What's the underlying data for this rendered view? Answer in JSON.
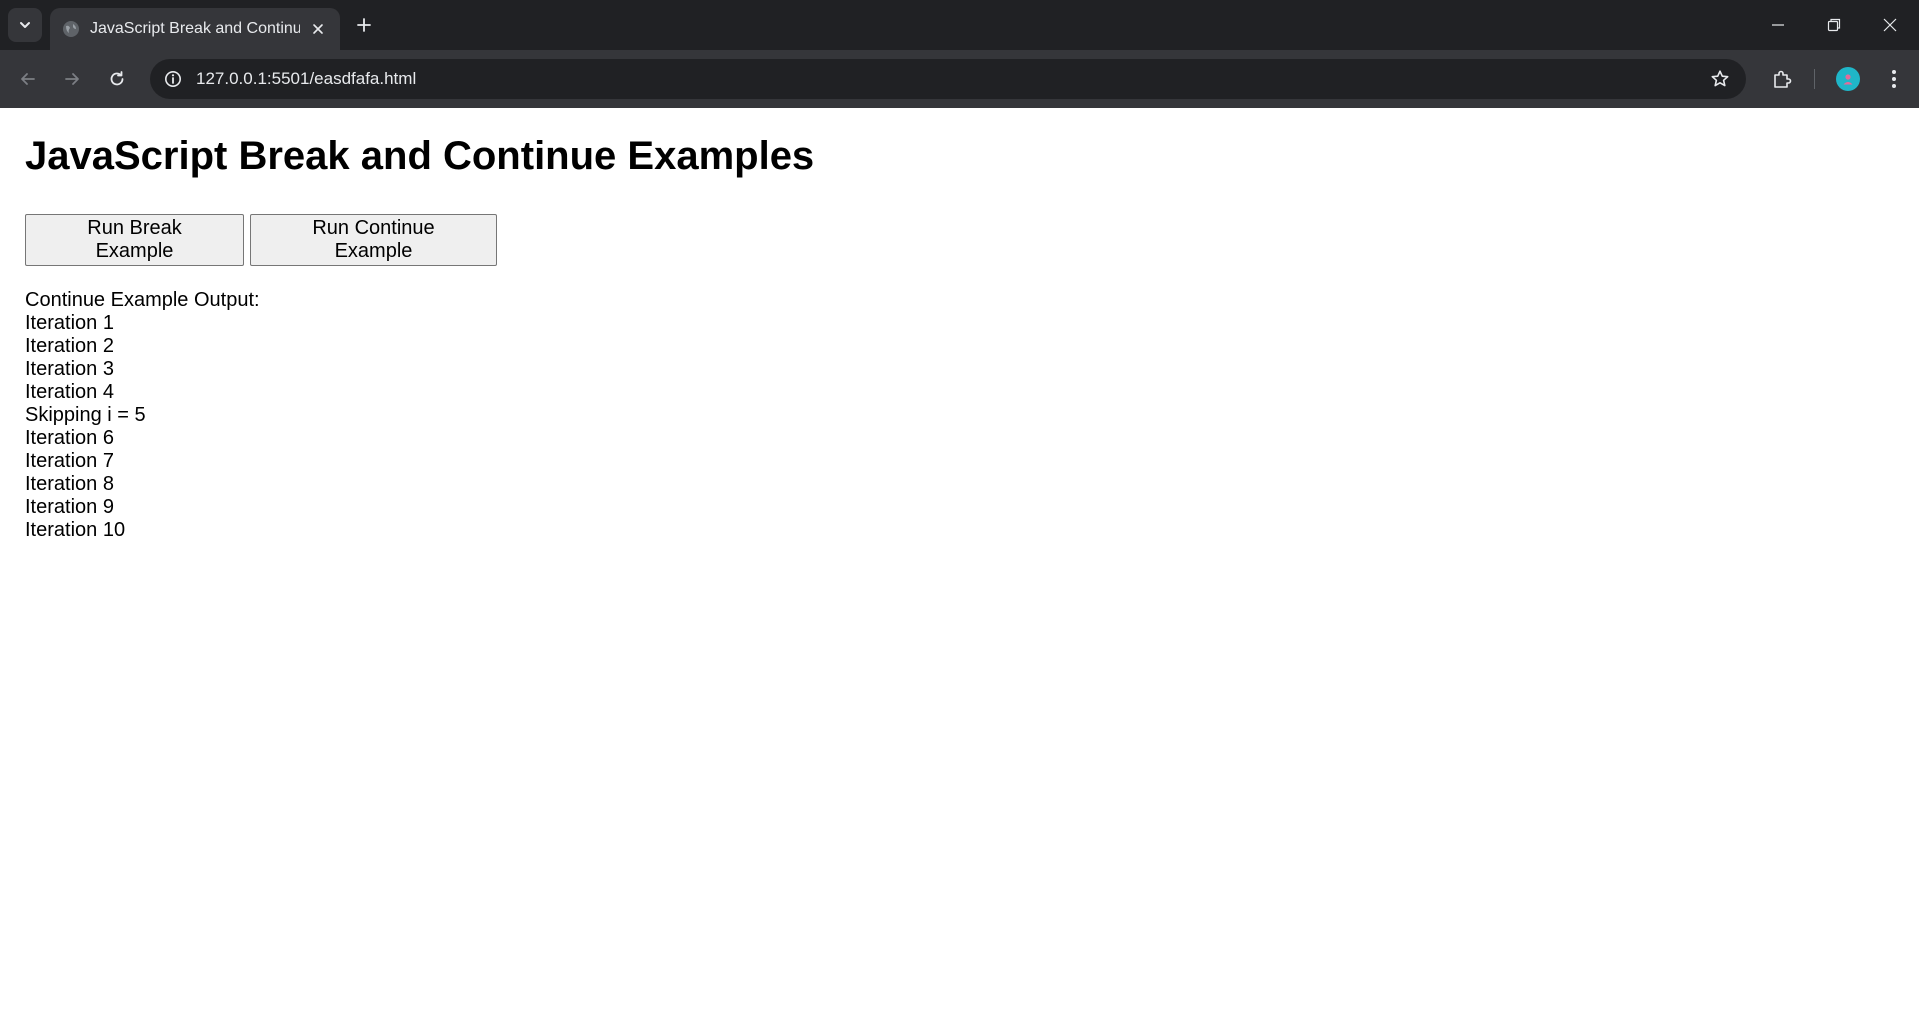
{
  "browser": {
    "tab": {
      "title": "JavaScript Break and Continue"
    },
    "address_bar": {
      "url": "127.0.0.1:5501/easdfafa.html"
    }
  },
  "page": {
    "heading": "JavaScript Break and Continue Examples",
    "buttons": {
      "break_label": "Run Break Example",
      "continue_label": "Run Continue Example"
    },
    "output": {
      "header": "Continue Example Output:",
      "lines": [
        "Iteration 1",
        "Iteration 2",
        "Iteration 3",
        "Iteration 4",
        "Skipping i = 5",
        "Iteration 6",
        "Iteration 7",
        "Iteration 8",
        "Iteration 9",
        "Iteration 10"
      ]
    }
  },
  "colors": {
    "tabstrip_bg": "#202124",
    "toolbar_bg": "#35363a",
    "avatar": "#1fb6c8",
    "button_bg": "#efefef"
  },
  "icons": {
    "tab_search": "chevron-down-icon",
    "favicon": "globe-icon",
    "tab_close": "close-icon",
    "new_tab": "plus-icon",
    "back": "arrow-left-icon",
    "forward": "arrow-right-icon",
    "reload": "reload-icon",
    "site_info": "info-icon",
    "bookmark": "star-icon",
    "extensions": "puzzle-icon",
    "menu": "more-vert-icon"
  }
}
